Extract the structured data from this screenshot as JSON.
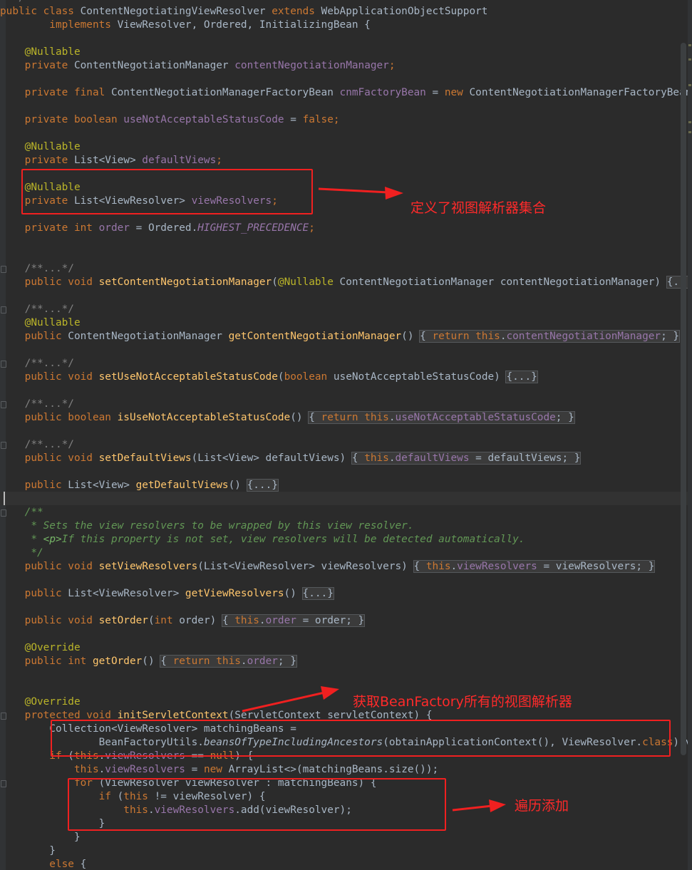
{
  "editor": {
    "lines": {
      "l0": {
        "t1": "public class",
        "t2": " ContentNegotiatingViewResolver ",
        "t3": "extends",
        "t4": " WebApplicationObjectSupport"
      },
      "l1": {
        "t1": "        implements",
        "t2": " ViewResolver, Ordered, InitializingBean {"
      },
      "l3": {
        "t1": "    @Nullable"
      },
      "l4": {
        "t1": "    private",
        "t2": " ContentNegotiationManager ",
        "t3": "contentNegotiationManager",
        "t4": ";"
      },
      "l6": {
        "t1": "    private final",
        "t2": " ContentNegotiationManagerFactoryBean ",
        "t3": "cnmFactoryBean",
        "t4": " = ",
        "t5": "new",
        "t6": " ContentNegotiationManagerFactoryBean();"
      },
      "l8": {
        "t1": "    private boolean",
        "t2": " useNotAcceptableStatusCode",
        "t3": " = ",
        "t4": "false",
        "t5": ";"
      },
      "l10": {
        "t1": "    @Nullable"
      },
      "l11": {
        "t1": "    private",
        "t2": " List<View> ",
        "t3": "defaultViews",
        "t4": ";"
      },
      "l13": {
        "t1": "    @Nullable"
      },
      "l14": {
        "t1": "    private",
        "t2": " List<ViewResolver> ",
        "t3": "viewResolvers",
        "t4": ";"
      },
      "l16": {
        "t1": "    private int",
        "t2": " order",
        "t3": " = Ordered.",
        "t4": "HIGHEST_PRECEDENCE",
        "t5": ";"
      },
      "l19": {
        "t1": "    /**...*/"
      },
      "l20": {
        "t1": "    public void",
        "t2": " setContentNegotiationManager",
        "t3": "(",
        "t4": "@Nullable",
        "t5": " ContentNegotiationManager contentNegotiationManager) ",
        "t6": "{...}"
      },
      "l22": {
        "t1": "    /**...*/"
      },
      "l23": {
        "t1": "    @Nullable"
      },
      "l24": {
        "t1": "    public",
        "t2": " ContentNegotiationManager ",
        "t3": "getContentNegotiationManager",
        "t4": "() ",
        "t5": "{ ",
        "t6": "return this",
        "t7": ".",
        "t8": "contentNegotiationManager",
        "t9": "; }"
      },
      "l26": {
        "t1": "    /**...*/"
      },
      "l27": {
        "t1": "    public void",
        "t2": " setUseNotAcceptableStatusCode",
        "t3": "(",
        "t4": "boolean",
        "t5": " useNotAcceptableStatusCode) ",
        "t6": "{...}"
      },
      "l29": {
        "t1": "    /**...*/"
      },
      "l30": {
        "t1": "    public boolean",
        "t2": " isUseNotAcceptableStatusCode",
        "t3": "() ",
        "t4": "{ ",
        "t5": "return this",
        "t6": ".",
        "t7": "useNotAcceptableStatusCode",
        "t8": "; }"
      },
      "l32": {
        "t1": "    /**...*/"
      },
      "l33": {
        "t1": "    public void",
        "t2": " setDefaultViews",
        "t3": "(List<View> defaultViews) ",
        "t4": "{ ",
        "t5": "this",
        "t6": ".",
        "t7": "defaultViews",
        "t8": " = defaultViews; }"
      },
      "l35": {
        "t1": "    public",
        "t2": " List<View> ",
        "t3": "getDefaultViews",
        "t4": "() ",
        "t5": "{...}"
      },
      "l37": {
        "t1": "    /**"
      },
      "l38": {
        "t1": "     * Sets the view resolvers to be wrapped by this view resolver."
      },
      "l39": {
        "t1": "     * ",
        "t2": "<p>",
        "t3": "If this property is not set, view resolvers will be detected automatically."
      },
      "l40": {
        "t1": "     */"
      },
      "l41": {
        "t1": "    public void",
        "t2": " setViewResolvers",
        "t3": "(List<ViewResolver> viewResolvers) ",
        "t4": "{ ",
        "t5": "this",
        "t6": ".",
        "t7": "viewResolvers",
        "t8": " = viewResolvers; }"
      },
      "l43": {
        "t1": "    public",
        "t2": " List<ViewResolver> ",
        "t3": "getViewResolvers",
        "t4": "() ",
        "t5": "{...}"
      },
      "l45": {
        "t1": "    public void",
        "t2": " setOrder",
        "t3": "(",
        "t4": "int",
        "t5": " order) ",
        "t6": "{ ",
        "t7": "this",
        "t8": ".",
        "t9": "order",
        "t10": " = order; }"
      },
      "l47": {
        "t1": "    @Override"
      },
      "l48": {
        "t1": "    public int",
        "t2": " getOrder",
        "t3": "() ",
        "t4": "{ ",
        "t5": "return this",
        "t6": ".",
        "t7": "order",
        "t8": "; }"
      },
      "l51": {
        "t1": "    @Override"
      },
      "l52": {
        "t1": "    protected void",
        "t2": " initServletContext",
        "t3": "(ServletContext servletContext) {"
      },
      "l53": {
        "t1": "        Collection<ViewResolver> matchingBeans ="
      },
      "l54": {
        "t1": "                BeanFactoryUtils.",
        "t2": "beansOfTypeIncludingAncestors",
        "t3": "(obtainApplicationContext(), ViewResolver.",
        "t4": "class",
        "t5": ").values();"
      },
      "l55": {
        "t1": "        if",
        "t2": " (",
        "t3": "this",
        "t4": ".",
        "t5": "viewResolvers",
        "t6": " == ",
        "t7": "null",
        "t8": ") {"
      },
      "l56": {
        "t1": "            this",
        "t2": ".",
        "t3": "viewResolvers",
        "t4": " = ",
        "t5": "new",
        "t6": " ArrayList<>(matchingBeans.size());"
      },
      "l57": {
        "t1": "            for",
        "t2": " (ViewResolver viewResolver : matchingBeans) {"
      },
      "l58": {
        "t1": "                if",
        "t2": " (",
        "t3": "this",
        "t4": " != viewResolver) {"
      },
      "l59": {
        "t1": "                    this",
        "t2": ".",
        "t3": "viewResolvers",
        "t4": ".add(viewResolver);"
      },
      "l60": {
        "t1": "                }"
      },
      "l61": {
        "t1": "            }"
      },
      "l62": {
        "t1": "        }"
      },
      "l63": {
        "t1": "        else",
        "t2": " {"
      }
    }
  },
  "annotations": {
    "a1": "定义了视图解析器集合",
    "a2": "获取BeanFactory所有的视图解析器",
    "a3": "遍历添加"
  }
}
